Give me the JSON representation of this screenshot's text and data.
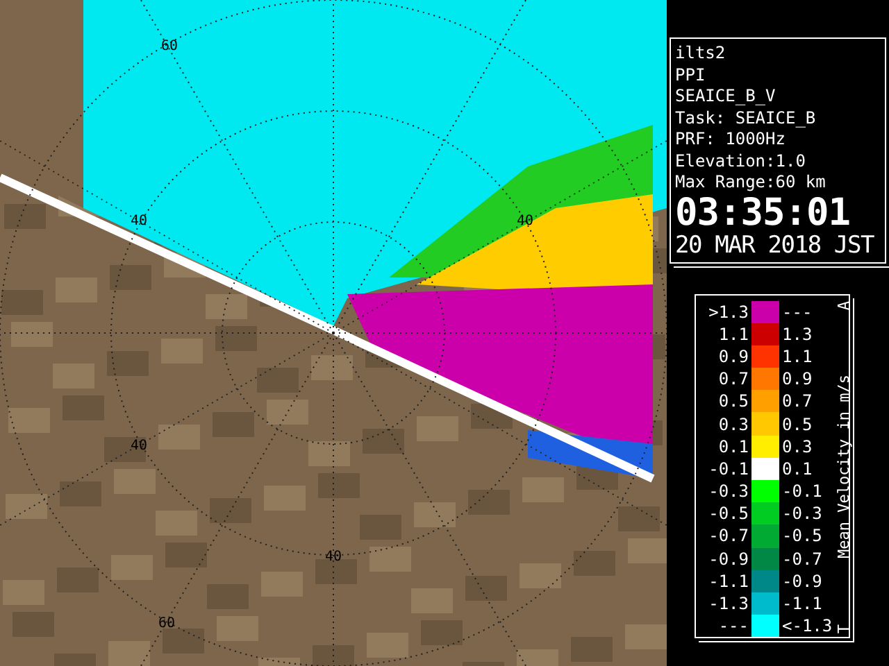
{
  "map": {
    "range_labels": [
      "60",
      "40",
      "40",
      "40",
      "40",
      "60"
    ]
  },
  "info": {
    "lines": [
      "ilts2",
      "PPI",
      "SEAICE_B_V",
      "Task: SEAICE_B",
      "PRF: 1000Hz",
      "Elevation:1.0",
      "Max Range:60 km"
    ],
    "time": "03:35:01",
    "date": "20 MAR 2018 JST"
  },
  "legend": {
    "title": "Mean Velocity in m/s",
    "top_mark": "A",
    "bottom_mark": "T",
    "rows": [
      {
        "low": ">1.3",
        "high": "---",
        "color": "#cc00aa"
      },
      {
        "low": "1.1",
        "high": "1.3",
        "color": "#cc0000"
      },
      {
        "low": "0.9",
        "high": "1.1",
        "color": "#ff3300"
      },
      {
        "low": "0.7",
        "high": "0.9",
        "color": "#ff7700"
      },
      {
        "low": "0.5",
        "high": "0.7",
        "color": "#ffa000"
      },
      {
        "low": "0.3",
        "high": "0.5",
        "color": "#ffc800"
      },
      {
        "low": "0.1",
        "high": "0.3",
        "color": "#ffee00"
      },
      {
        "low": "-0.1",
        "high": "0.1",
        "color": "#ffffff"
      },
      {
        "low": "-0.3",
        "high": "-0.1",
        "color": "#00ff00"
      },
      {
        "low": "-0.5",
        "high": "-0.3",
        "color": "#00cc22"
      },
      {
        "low": "-0.7",
        "high": "-0.5",
        "color": "#00aa33"
      },
      {
        "low": "-0.9",
        "high": "-0.7",
        "color": "#008844"
      },
      {
        "low": "-1.1",
        "high": "-0.9",
        "color": "#008888"
      },
      {
        "low": "-1.3",
        "high": "-1.1",
        "color": "#00bbcc"
      },
      {
        "low": "---",
        "high": "<-1.3",
        "color": "#00ffff"
      }
    ]
  }
}
